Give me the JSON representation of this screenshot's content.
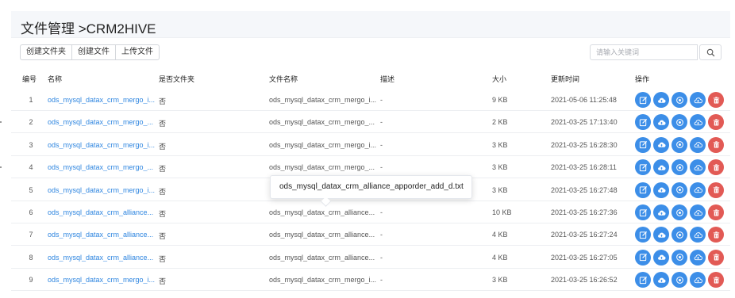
{
  "header": {
    "title": "文件管理 >CRM2HIVE"
  },
  "toolbar": {
    "create_folder": "创建文件夹",
    "create_file": "创建文件",
    "upload_file": "上传文件"
  },
  "search": {
    "placeholder": "请输入关键词",
    "icon": "search-icon"
  },
  "table": {
    "columns": {
      "idx": "编号",
      "name": "名称",
      "is_dir": "是否文件夹",
      "file_name": "文件名称",
      "desc": "描述",
      "size": "大小",
      "updated": "更新时间",
      "ops": "操作"
    },
    "rows": [
      {
        "idx": "1",
        "name": "ods_mysql_datax_crm_mergo_i...",
        "is_dir": "否",
        "file_name": "ods_mysql_datax_crm_mergo_i...",
        "desc": "-",
        "size": "9 KB",
        "updated": "2021-05-06 11:25:48"
      },
      {
        "idx": "2",
        "name": "ods_mysql_datax_crm_mergo_...",
        "is_dir": "否",
        "file_name": "ods_mysql_datax_crm_mergo_...",
        "desc": "-",
        "size": "2 KB",
        "updated": "2021-03-25 17:13:40"
      },
      {
        "idx": "3",
        "name": "ods_mysql_datax_crm_mergo_i...",
        "is_dir": "否",
        "file_name": "ods_mysql_datax_crm_mergo_i...",
        "desc": "-",
        "size": "3 KB",
        "updated": "2021-03-25 16:28:30"
      },
      {
        "idx": "4",
        "name": "ods_mysql_datax_crm_mergo_...",
        "is_dir": "否",
        "file_name": "ods_mysql_datax_crm_mergo_...",
        "desc": "-",
        "size": "3 KB",
        "updated": "2021-03-25 16:28:11"
      },
      {
        "idx": "5",
        "name": "ods_mysql_datax_crm_mergo_i...",
        "is_dir": "否",
        "file_name": "",
        "desc": "",
        "size": "3 KB",
        "updated": "2021-03-25 16:27:48"
      },
      {
        "idx": "6",
        "name": "ods_mysql_datax_crm_alliance...",
        "is_dir": "否",
        "file_name": "ods_mysql_datax_crm_alliance...",
        "desc": "-",
        "size": "10 KB",
        "updated": "2021-03-25 16:27:36"
      },
      {
        "idx": "7",
        "name": "ods_mysql_datax_crm_alliance...",
        "is_dir": "否",
        "file_name": "ods_mysql_datax_crm_alliance...",
        "desc": "-",
        "size": "4 KB",
        "updated": "2021-03-25 16:27:24"
      },
      {
        "idx": "8",
        "name": "ods_mysql_datax_crm_alliance...",
        "is_dir": "否",
        "file_name": "ods_mysql_datax_crm_alliance...",
        "desc": "-",
        "size": "4 KB",
        "updated": "2021-03-25 16:27:05"
      },
      {
        "idx": "9",
        "name": "ods_mysql_datax_crm_mergo_i...",
        "is_dir": "否",
        "file_name": "ods_mysql_datax_crm_mergo_i...",
        "desc": "-",
        "size": "3 KB",
        "updated": "2021-03-25 16:26:52"
      }
    ]
  },
  "row_actions": [
    {
      "icon": "edit-icon",
      "color": "#3c8ee8"
    },
    {
      "icon": "cloud-upload-icon",
      "color": "#3c8ee8"
    },
    {
      "icon": "view-icon",
      "color": "#3c8ee8"
    },
    {
      "icon": "cloud-download-icon",
      "color": "#3c8ee8"
    },
    {
      "icon": "trash-icon",
      "color": "#e25a55"
    }
  ],
  "tooltip": {
    "text": "ods_mysql_datax_crm_alliance_apporder_add_d.txt"
  },
  "colors": {
    "link": "#2f86e0",
    "primary": "#3c8ee8",
    "danger": "#e25a55",
    "header_bg": "#f5f7fa"
  }
}
